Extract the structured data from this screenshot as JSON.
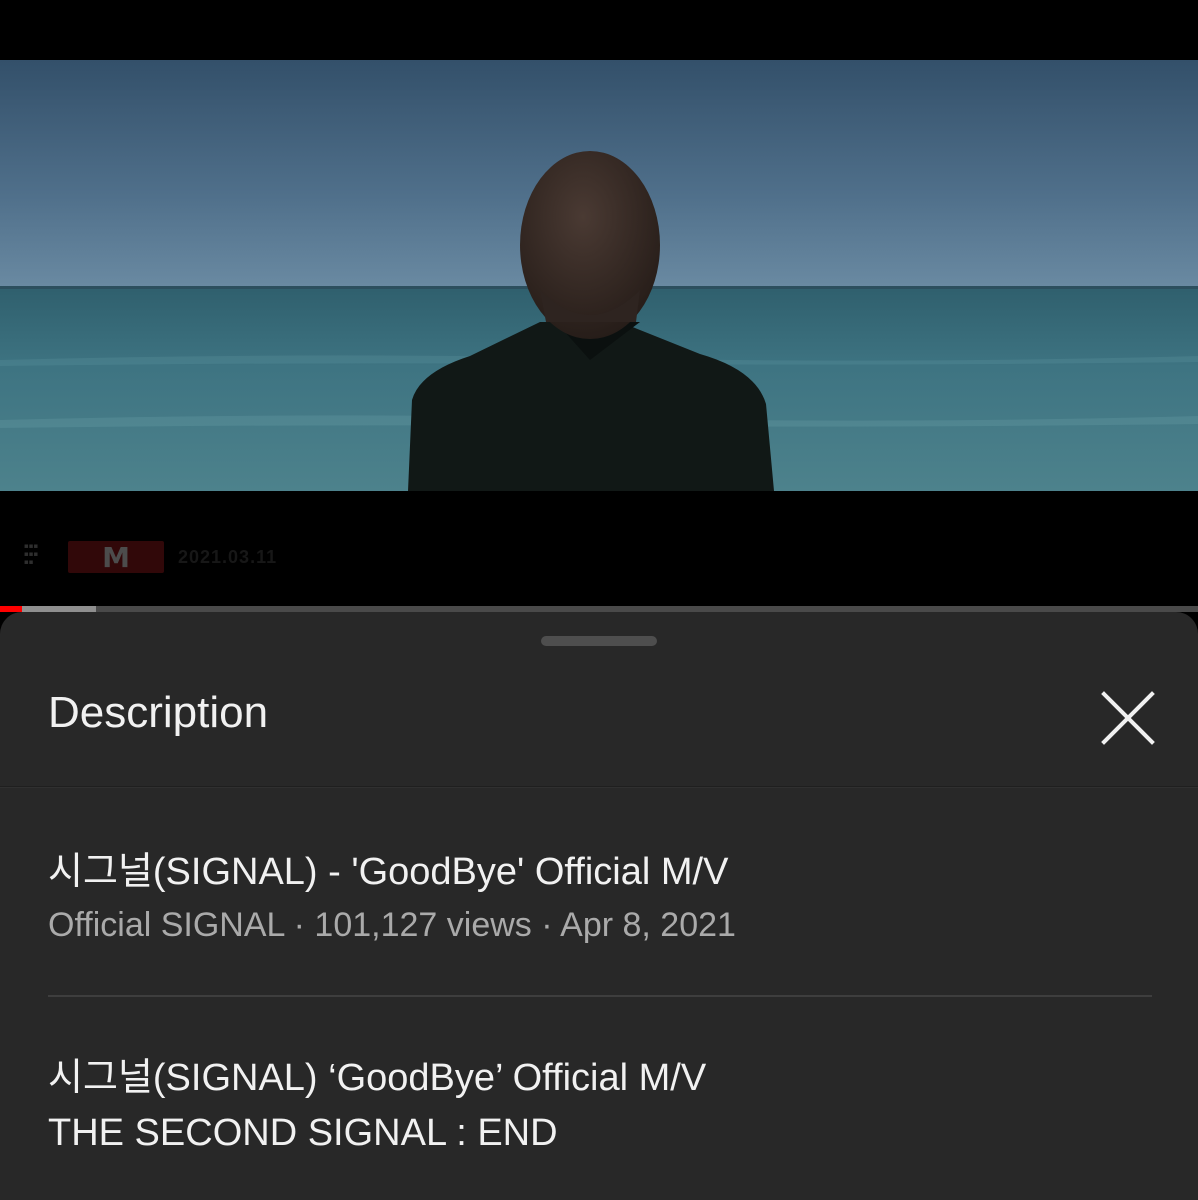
{
  "player": {
    "watermark": {
      "brand_letter": "M",
      "date": "2021.03.11"
    },
    "progress": {
      "played_fraction": 0.018,
      "buffered_fraction": 0.08
    }
  },
  "sheet": {
    "title": "Description",
    "close_icon": "close-icon"
  },
  "video": {
    "title": "시그널(SIGNAL) - 'GoodBye' Official M/V",
    "channel": "Official SIGNAL",
    "views": "101,127 views",
    "date": "Apr 8, 2021",
    "separator": " · "
  },
  "description": {
    "lines": [
      "시그널(SIGNAL) ‘GoodBye’ Official M/V",
      "THE SECOND SIGNAL : END"
    ]
  },
  "colors": {
    "sheet_background": "#282828",
    "progress_played": "#ff0000",
    "text_primary": "#f1f1f1",
    "text_secondary": "#aaaaaa"
  }
}
